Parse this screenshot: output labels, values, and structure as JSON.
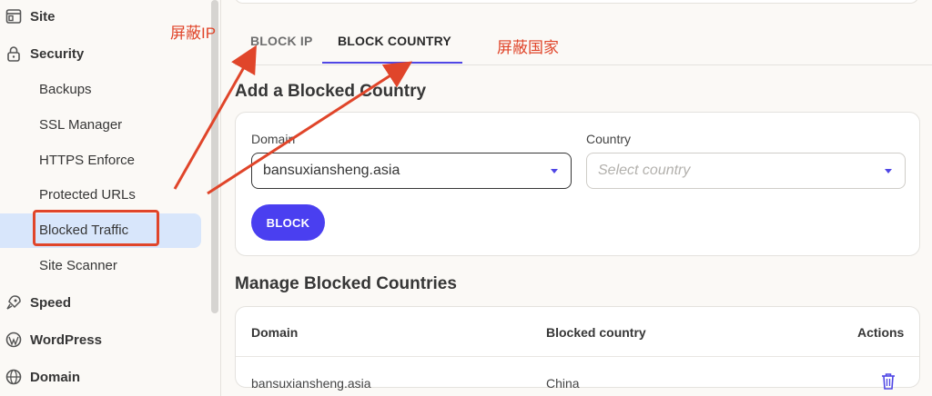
{
  "sidebar": {
    "sections": [
      {
        "label": "Site",
        "icon": "site-icon"
      },
      {
        "label": "Security",
        "icon": "lock-icon"
      },
      {
        "label": "Speed",
        "icon": "rocket-icon"
      },
      {
        "label": "WordPress",
        "icon": "wordpress-icon"
      },
      {
        "label": "Domain",
        "icon": "globe-icon"
      }
    ],
    "security_items": [
      "Backups",
      "SSL Manager",
      "HTTPS Enforce",
      "Protected URLs",
      "Blocked Traffic",
      "Site Scanner"
    ],
    "active_item": "Blocked Traffic"
  },
  "tabs": {
    "block_ip": "BLOCK IP",
    "block_country": "BLOCK COUNTRY",
    "active": "BLOCK COUNTRY"
  },
  "add_form": {
    "title": "Add a Blocked Country",
    "domain_label": "Domain",
    "domain_value": "bansuxiansheng.asia",
    "country_label": "Country",
    "country_placeholder": "Select country",
    "submit_label": "BLOCK"
  },
  "manage": {
    "title": "Manage Blocked Countries",
    "columns": [
      "Domain",
      "Blocked country",
      "Actions"
    ],
    "rows": [
      {
        "domain": "bansuxiansheng.asia",
        "country": "China",
        "action_icon": "trash-icon"
      }
    ]
  },
  "annotations": {
    "block_ip_note": "屏蔽IP",
    "block_country_note": "屏蔽国家",
    "color": "#e0452a"
  },
  "colors": {
    "accent": "#4f46e5",
    "button": "#4a3ff0",
    "active_nav_bg": "#d8e6fb"
  }
}
